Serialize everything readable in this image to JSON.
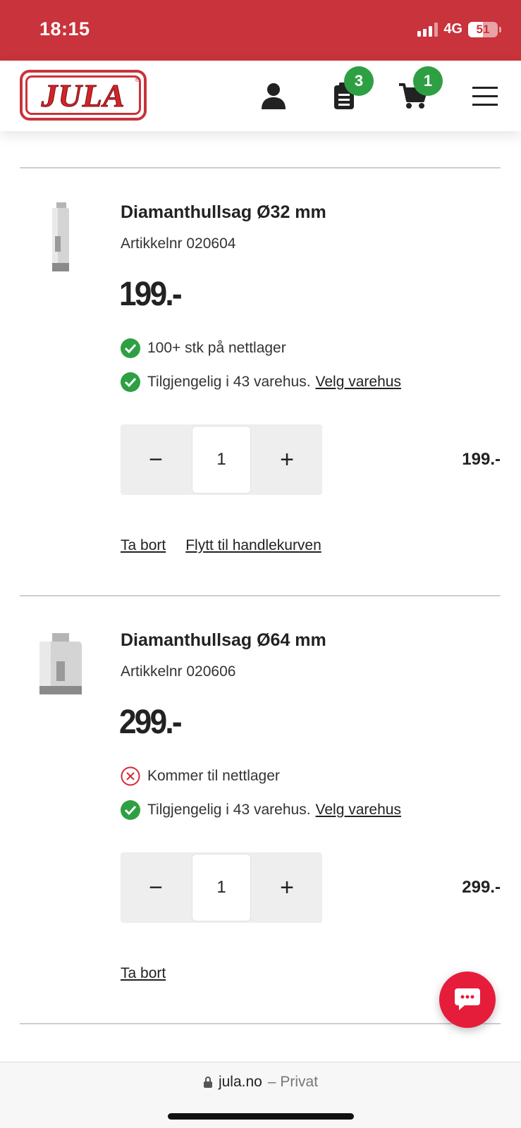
{
  "status_bar": {
    "time": "18:15",
    "network": "4G",
    "battery": "51",
    "battery_level": 0.51
  },
  "header": {
    "logo": "JULA",
    "wishlist_count": "3",
    "cart_count": "1",
    "icons": [
      "user-icon",
      "list-icon",
      "cart-icon",
      "menu-icon"
    ]
  },
  "items": [
    {
      "title": "Diamanthullsag Ø32 mm",
      "article": "Artikkelnr 020604",
      "price": "199.-",
      "stock_online": "100+ stk på nettlager",
      "stock_online_status": "available",
      "stock_store": "Tilgjengelig i 43 varehus.",
      "store_link": "Velg varehus",
      "quantity": "1",
      "row_price": "199.-",
      "remove": "Ta bort",
      "move": "Flytt til handlekurven"
    },
    {
      "title": "Diamanthullsag Ø64 mm",
      "article": "Artikkelnr 020606",
      "price": "299.-",
      "stock_online": "Kommer til nettlager",
      "stock_online_status": "unavailable",
      "stock_store": "Tilgjengelig i 43 varehus.",
      "store_link": "Velg varehus",
      "quantity": "1",
      "row_price": "299.-",
      "remove": "Ta bort"
    }
  ],
  "browser": {
    "domain": "jula.no",
    "mode": "– Privat"
  },
  "colors": {
    "brand_red": "#c9333b",
    "badge_green": "#2ea043",
    "chat_red": "#e51d3a"
  }
}
